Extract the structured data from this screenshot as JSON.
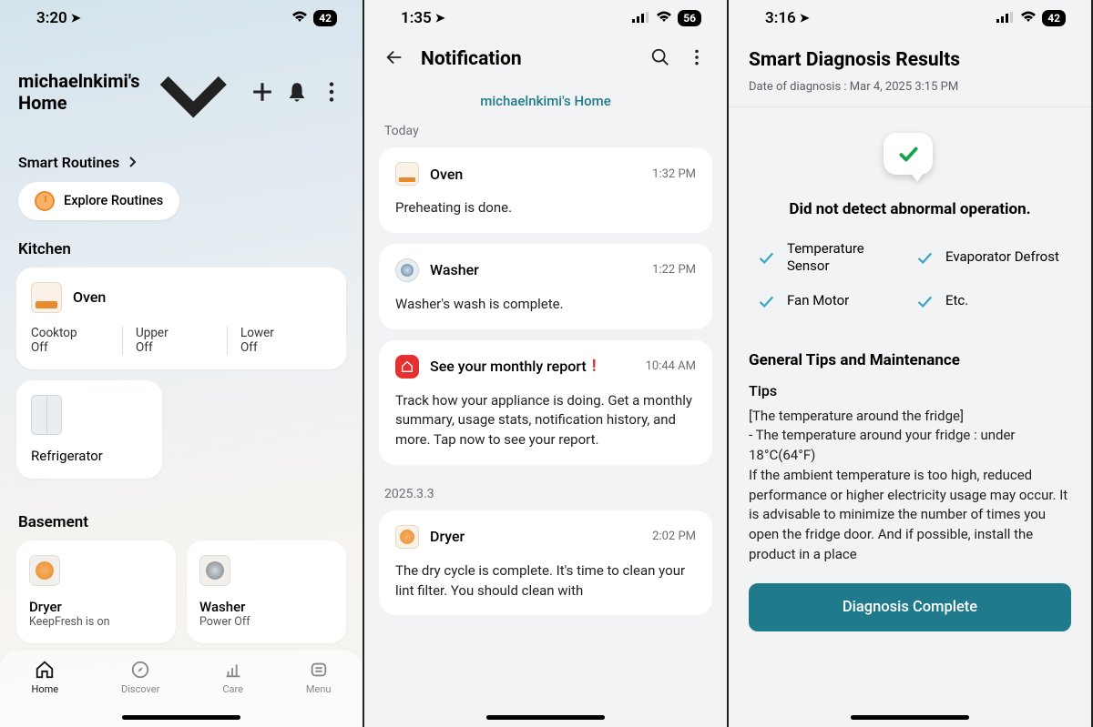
{
  "pane1": {
    "status": {
      "time": "3:20",
      "battery": "42"
    },
    "title": "michaelnkimi's Home",
    "routines": {
      "heading": "Smart Routines",
      "chip": "Explore Routines"
    },
    "kitchen": {
      "label": "Kitchen",
      "oven": {
        "name": "Oven",
        "cols": [
          {
            "label": "Cooktop",
            "value": "Off"
          },
          {
            "label": "Upper",
            "value": "Off"
          },
          {
            "label": "Lower",
            "value": "Off"
          }
        ]
      },
      "fridge": "Refrigerator"
    },
    "basement": {
      "label": "Basement",
      "dryer": {
        "name": "Dryer",
        "sub": "KeepFresh is on"
      },
      "washer": {
        "name": "Washer",
        "sub": "Power Off"
      }
    },
    "tabs": {
      "home": "Home",
      "discover": "Discover",
      "care": "Care",
      "menu": "Menu"
    }
  },
  "pane2": {
    "status": {
      "time": "1:35",
      "battery": "56"
    },
    "title": "Notification",
    "home_link": "michaelnkimi's Home",
    "today_label": "Today",
    "cards": {
      "oven": {
        "title": "Oven",
        "time": "1:32 PM",
        "body": "Preheating is done."
      },
      "washer": {
        "title": "Washer",
        "time": "1:22 PM",
        "body": "Washer's wash is complete."
      },
      "report": {
        "title": "See your monthly report",
        "time": "10:44 AM",
        "body": "Track how your appliance is doing. Get a monthly summary, usage stats, notification history, and more. Tap now to see your report."
      },
      "date2": "2025.3.3",
      "dryer": {
        "title": "Dryer",
        "time": "2:02 PM",
        "body": "The dry cycle is complete. It's time to clean your lint filter. You should clean with "
      }
    }
  },
  "pane3": {
    "status": {
      "time": "3:16",
      "battery": "42"
    },
    "title": "Smart Diagnosis Results",
    "date": "Date of diagnosis : Mar 4, 2025 3:15 PM",
    "result_msg": "Did not detect abnormal operation.",
    "checks": {
      "a": "Temperature Sensor",
      "b": "Evaporator Defrost",
      "c": "Fan Motor",
      "d": "Etc."
    },
    "tips": {
      "heading": "General Tips and Maintenance",
      "sub": "Tips",
      "body": "[The temperature around the fridge]\n - The temperature around your fridge : under 18°C(64°F)\nIf the ambient temperature is too high, reduced performance or higher electricity usage may occur. It is advisable to minimize the number of times you open the fridge door. And if possible, install the product in a place"
    },
    "button": "Diagnosis Complete"
  }
}
